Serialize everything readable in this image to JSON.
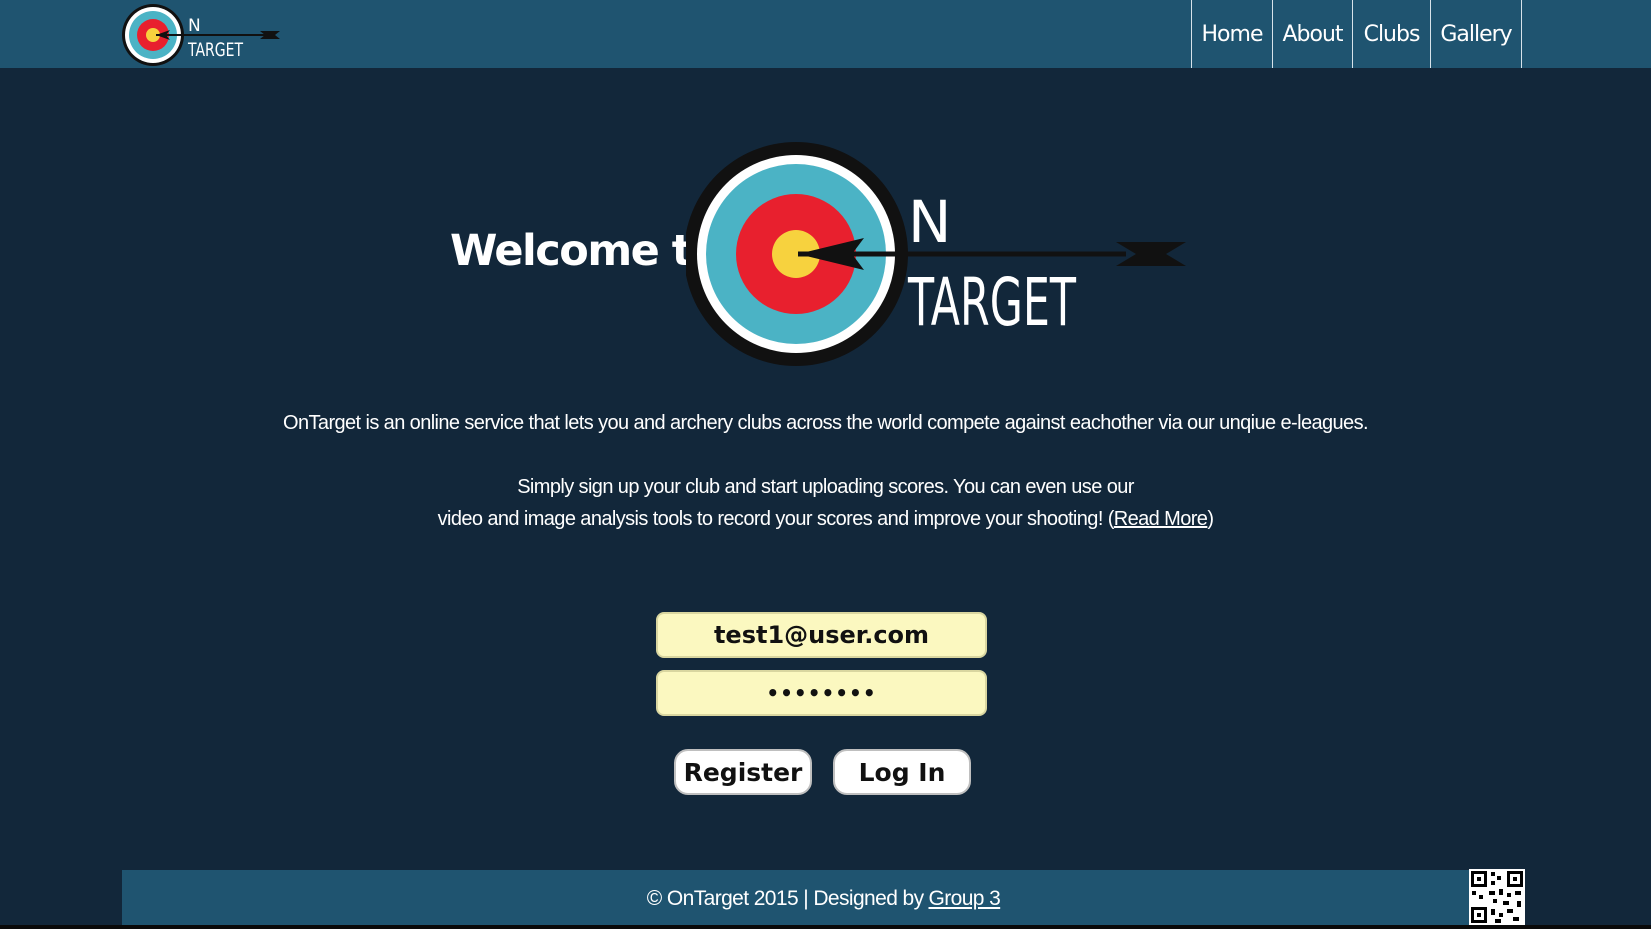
{
  "header": {
    "logo_letter_n": "N",
    "logo_word": "TARGET",
    "nav": [
      {
        "label": "Home"
      },
      {
        "label": "About"
      },
      {
        "label": "Clubs"
      },
      {
        "label": "Gallery"
      }
    ]
  },
  "hero": {
    "welcome": "Welcome to",
    "logo_letter_n": "N",
    "logo_word": "TARGET"
  },
  "intro": {
    "line1": "OnTarget is an online service that lets you and archery clubs across the world compete against eachother via our unqiue e-leagues.",
    "line2": "Simply sign up your club and start uploading scores. You can even use our",
    "line3_prefix": "video and image analysis tools to record your scores and improve your shooting! (",
    "read_more": "Read More",
    "line3_suffix": ")"
  },
  "login": {
    "email_value": "test1@user.com",
    "password_mask": "••••••••",
    "register_label": "Register",
    "login_label": "Log In"
  },
  "footer": {
    "text": "© OnTarget 2015 | Designed by",
    "link": "Group 3"
  },
  "colors": {
    "background": "#12273a",
    "bar": "#1f5470",
    "field": "#fbf8c0",
    "target_red": "#e8202e",
    "target_blue": "#4bb3c5",
    "target_gold": "#f7d23e"
  }
}
